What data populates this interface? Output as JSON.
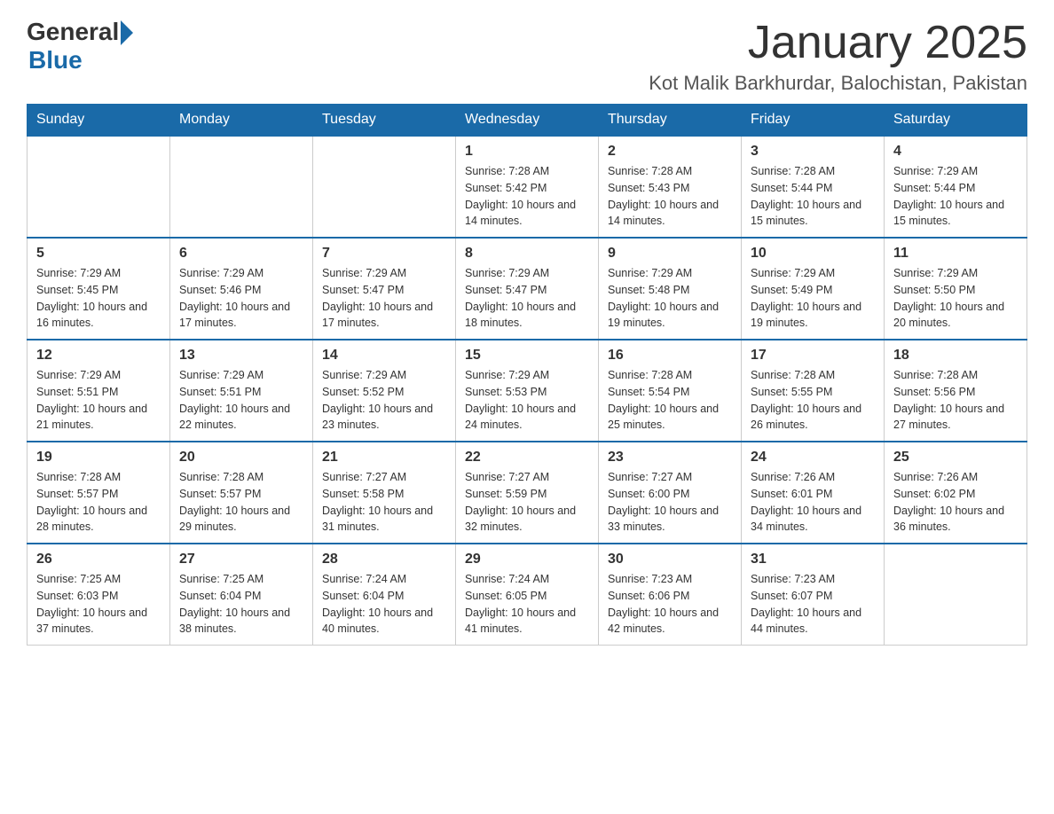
{
  "logo": {
    "general": "General",
    "blue": "Blue"
  },
  "title": "January 2025",
  "location": "Kot Malik Barkhurdar, Balochistan, Pakistan",
  "days_of_week": [
    "Sunday",
    "Monday",
    "Tuesday",
    "Wednesday",
    "Thursday",
    "Friday",
    "Saturday"
  ],
  "weeks": [
    [
      {
        "day": "",
        "info": ""
      },
      {
        "day": "",
        "info": ""
      },
      {
        "day": "",
        "info": ""
      },
      {
        "day": "1",
        "info": "Sunrise: 7:28 AM\nSunset: 5:42 PM\nDaylight: 10 hours and 14 minutes."
      },
      {
        "day": "2",
        "info": "Sunrise: 7:28 AM\nSunset: 5:43 PM\nDaylight: 10 hours and 14 minutes."
      },
      {
        "day": "3",
        "info": "Sunrise: 7:28 AM\nSunset: 5:44 PM\nDaylight: 10 hours and 15 minutes."
      },
      {
        "day": "4",
        "info": "Sunrise: 7:29 AM\nSunset: 5:44 PM\nDaylight: 10 hours and 15 minutes."
      }
    ],
    [
      {
        "day": "5",
        "info": "Sunrise: 7:29 AM\nSunset: 5:45 PM\nDaylight: 10 hours and 16 minutes."
      },
      {
        "day": "6",
        "info": "Sunrise: 7:29 AM\nSunset: 5:46 PM\nDaylight: 10 hours and 17 minutes."
      },
      {
        "day": "7",
        "info": "Sunrise: 7:29 AM\nSunset: 5:47 PM\nDaylight: 10 hours and 17 minutes."
      },
      {
        "day": "8",
        "info": "Sunrise: 7:29 AM\nSunset: 5:47 PM\nDaylight: 10 hours and 18 minutes."
      },
      {
        "day": "9",
        "info": "Sunrise: 7:29 AM\nSunset: 5:48 PM\nDaylight: 10 hours and 19 minutes."
      },
      {
        "day": "10",
        "info": "Sunrise: 7:29 AM\nSunset: 5:49 PM\nDaylight: 10 hours and 19 minutes."
      },
      {
        "day": "11",
        "info": "Sunrise: 7:29 AM\nSunset: 5:50 PM\nDaylight: 10 hours and 20 minutes."
      }
    ],
    [
      {
        "day": "12",
        "info": "Sunrise: 7:29 AM\nSunset: 5:51 PM\nDaylight: 10 hours and 21 minutes."
      },
      {
        "day": "13",
        "info": "Sunrise: 7:29 AM\nSunset: 5:51 PM\nDaylight: 10 hours and 22 minutes."
      },
      {
        "day": "14",
        "info": "Sunrise: 7:29 AM\nSunset: 5:52 PM\nDaylight: 10 hours and 23 minutes."
      },
      {
        "day": "15",
        "info": "Sunrise: 7:29 AM\nSunset: 5:53 PM\nDaylight: 10 hours and 24 minutes."
      },
      {
        "day": "16",
        "info": "Sunrise: 7:28 AM\nSunset: 5:54 PM\nDaylight: 10 hours and 25 minutes."
      },
      {
        "day": "17",
        "info": "Sunrise: 7:28 AM\nSunset: 5:55 PM\nDaylight: 10 hours and 26 minutes."
      },
      {
        "day": "18",
        "info": "Sunrise: 7:28 AM\nSunset: 5:56 PM\nDaylight: 10 hours and 27 minutes."
      }
    ],
    [
      {
        "day": "19",
        "info": "Sunrise: 7:28 AM\nSunset: 5:57 PM\nDaylight: 10 hours and 28 minutes."
      },
      {
        "day": "20",
        "info": "Sunrise: 7:28 AM\nSunset: 5:57 PM\nDaylight: 10 hours and 29 minutes."
      },
      {
        "day": "21",
        "info": "Sunrise: 7:27 AM\nSunset: 5:58 PM\nDaylight: 10 hours and 31 minutes."
      },
      {
        "day": "22",
        "info": "Sunrise: 7:27 AM\nSunset: 5:59 PM\nDaylight: 10 hours and 32 minutes."
      },
      {
        "day": "23",
        "info": "Sunrise: 7:27 AM\nSunset: 6:00 PM\nDaylight: 10 hours and 33 minutes."
      },
      {
        "day": "24",
        "info": "Sunrise: 7:26 AM\nSunset: 6:01 PM\nDaylight: 10 hours and 34 minutes."
      },
      {
        "day": "25",
        "info": "Sunrise: 7:26 AM\nSunset: 6:02 PM\nDaylight: 10 hours and 36 minutes."
      }
    ],
    [
      {
        "day": "26",
        "info": "Sunrise: 7:25 AM\nSunset: 6:03 PM\nDaylight: 10 hours and 37 minutes."
      },
      {
        "day": "27",
        "info": "Sunrise: 7:25 AM\nSunset: 6:04 PM\nDaylight: 10 hours and 38 minutes."
      },
      {
        "day": "28",
        "info": "Sunrise: 7:24 AM\nSunset: 6:04 PM\nDaylight: 10 hours and 40 minutes."
      },
      {
        "day": "29",
        "info": "Sunrise: 7:24 AM\nSunset: 6:05 PM\nDaylight: 10 hours and 41 minutes."
      },
      {
        "day": "30",
        "info": "Sunrise: 7:23 AM\nSunset: 6:06 PM\nDaylight: 10 hours and 42 minutes."
      },
      {
        "day": "31",
        "info": "Sunrise: 7:23 AM\nSunset: 6:07 PM\nDaylight: 10 hours and 44 minutes."
      },
      {
        "day": "",
        "info": ""
      }
    ]
  ]
}
